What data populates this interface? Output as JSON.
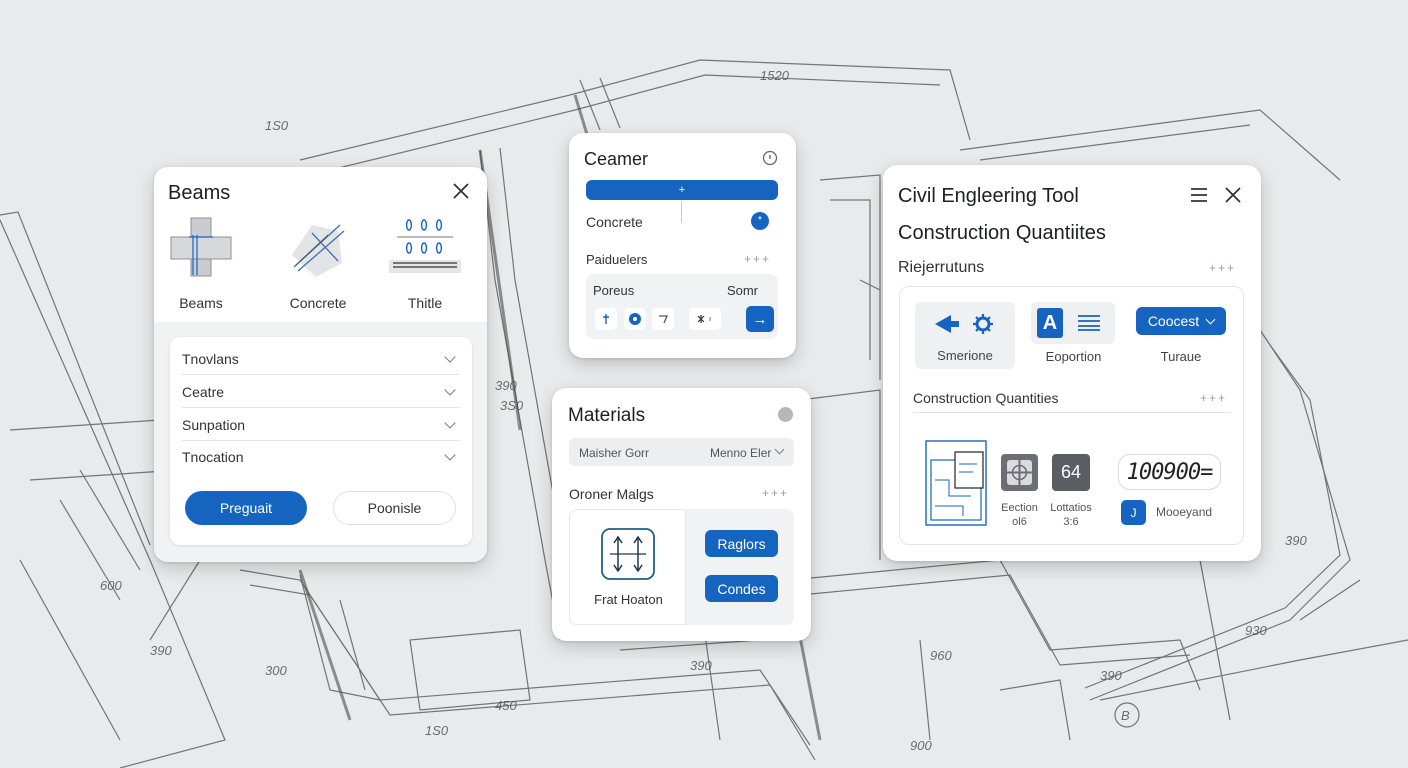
{
  "background": {
    "dimensions": [
      "1520",
      "1S0",
      "900",
      "930",
      "390",
      "1S0",
      "3S0",
      "960",
      "390",
      "390",
      "450",
      "600",
      "390",
      "300",
      "390"
    ],
    "marker": "B"
  },
  "beams_panel": {
    "title": "Beams",
    "tiles": [
      {
        "label": "Beams",
        "icon": "beam-cross-icon"
      },
      {
        "label": "Concrete",
        "icon": "concrete-icon"
      },
      {
        "label": "Thitle",
        "icon": "rebar-icon"
      }
    ],
    "rows": [
      "Tnovlans",
      "Ceatre",
      "Sunpation",
      "Tnocation"
    ],
    "primary_button": "Preguait",
    "secondary_button": "Poonisle"
  },
  "ceamer_panel": {
    "title": "Ceamer",
    "slider_marker": "+",
    "concrete_label": "Concrete",
    "knob_symbol": "*",
    "params_label": "Paiduelers",
    "params_dots": "+++",
    "box_left": "Poreus",
    "box_right": "Somr",
    "go_symbol": "→"
  },
  "materials_panel": {
    "title": "Materials",
    "select_left": "Maisher Gorr",
    "select_right": "Menno Eler",
    "subtitle": "Oroner Malgs",
    "subtitle_dots": "+++",
    "caption": "Frat Hoaton",
    "button_1": "Raglors",
    "button_2": "Condes"
  },
  "civil_panel": {
    "title": "Civil Engleering Tool",
    "subtitle": "Construction Quantiites",
    "section": "Riejerrutuns",
    "section_dots": "+++",
    "tile_1_label": "Smerione",
    "tile_2_label": "Eoportion",
    "dropdown_label": "Coocest",
    "dropdown_caption": "Turaue",
    "quantities_title": "Construction Quantities",
    "quantities_dots": "+++",
    "number_tile": "64",
    "label_1": [
      "Eection",
      "ol6"
    ],
    "label_2": [
      "Lottatios",
      "3:6"
    ],
    "readout": "100900=",
    "readout_icon": "J",
    "readout_label": "Mooeyand"
  },
  "colors": {
    "accent": "#1565c0",
    "background": "#e9eaeb",
    "line": "#3a3d42"
  }
}
